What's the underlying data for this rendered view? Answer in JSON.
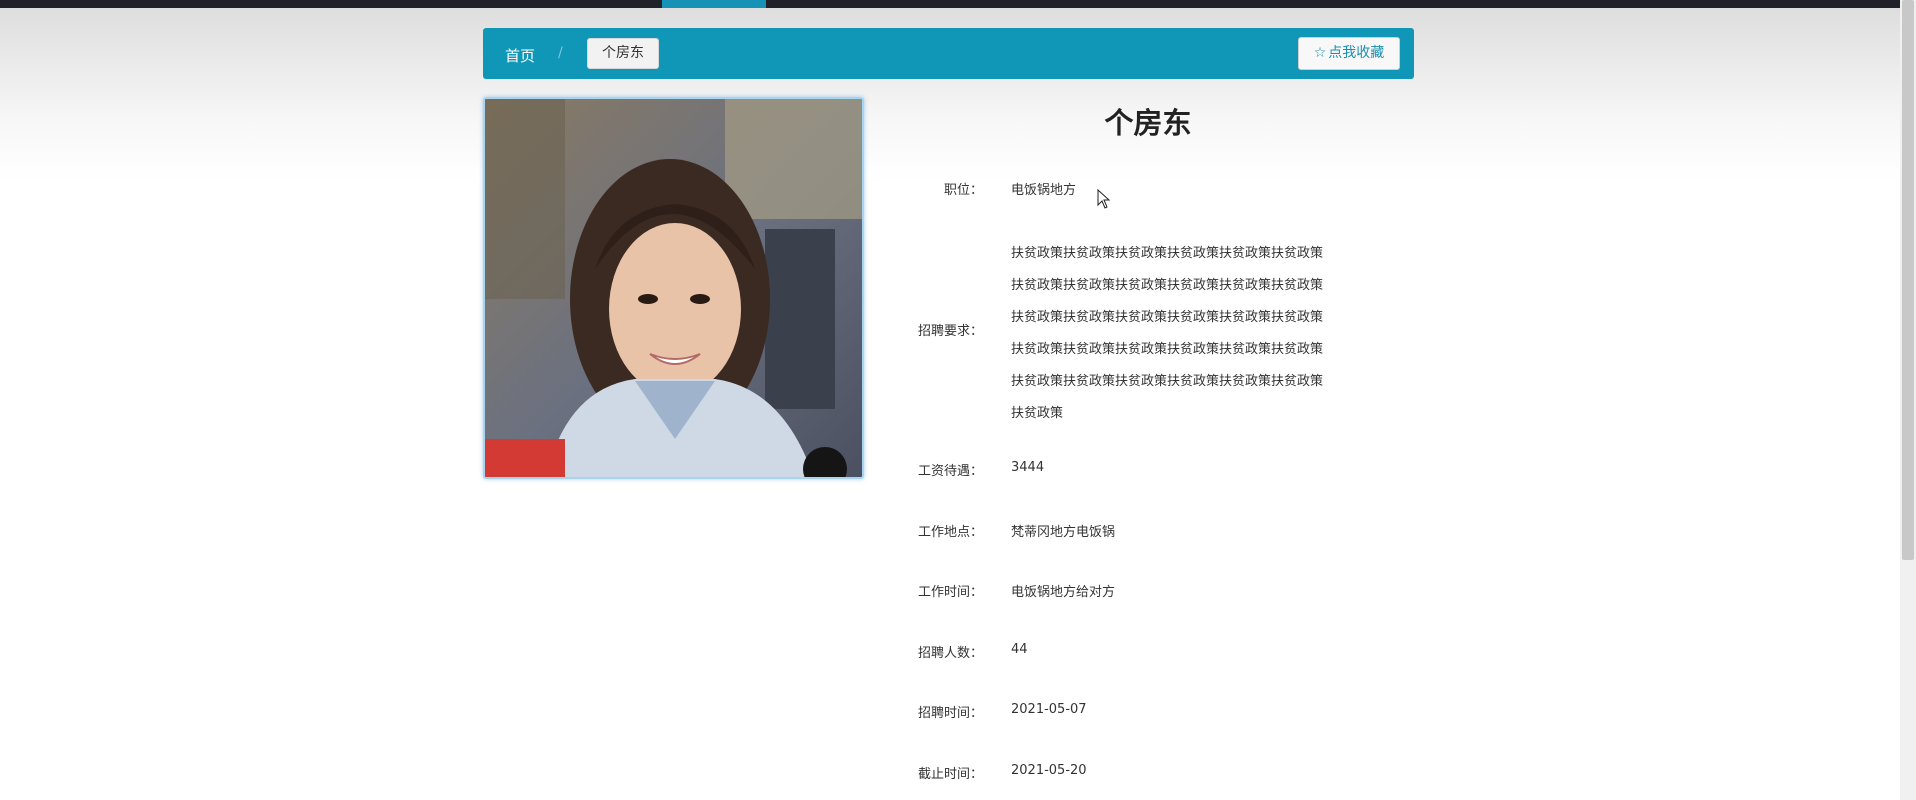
{
  "breadcrumb": {
    "home": "首页",
    "separator": "/",
    "current": "个房东"
  },
  "favorite": {
    "icon": "star-outline-icon",
    "label": "点我收藏"
  },
  "job": {
    "title": "个房东",
    "fields": [
      {
        "label": "职位：",
        "value": "电饭锅地方"
      },
      {
        "label": "招聘要求：",
        "value": ""
      },
      {
        "label": "工资待遇：",
        "value": "3444"
      },
      {
        "label": "工作地点：",
        "value": "梵蒂冈地方电饭锅"
      },
      {
        "label": "工作时间：",
        "value": "电饭锅地方给对方"
      },
      {
        "label": "招聘人数：",
        "value": "44"
      },
      {
        "label": "招聘时间：",
        "value": "2021-05-07"
      },
      {
        "label": "截止时间：",
        "value": "2021-05-20"
      }
    ],
    "requirement_lines": [
      "扶贫政策扶贫政策扶贫政策扶贫政策扶贫政策扶贫政策",
      "扶贫政策扶贫政策扶贫政策扶贫政策扶贫政策扶贫政策",
      "扶贫政策扶贫政策扶贫政策扶贫政策扶贫政策扶贫政策",
      "扶贫政策扶贫政策扶贫政策扶贫政策扶贫政策扶贫政策",
      "扶贫政策扶贫政策扶贫政策扶贫政策扶贫政策扶贫政策",
      "扶贫政策"
    ]
  },
  "colors": {
    "accent": "#1096b7",
    "topbar": "#1f2329"
  }
}
